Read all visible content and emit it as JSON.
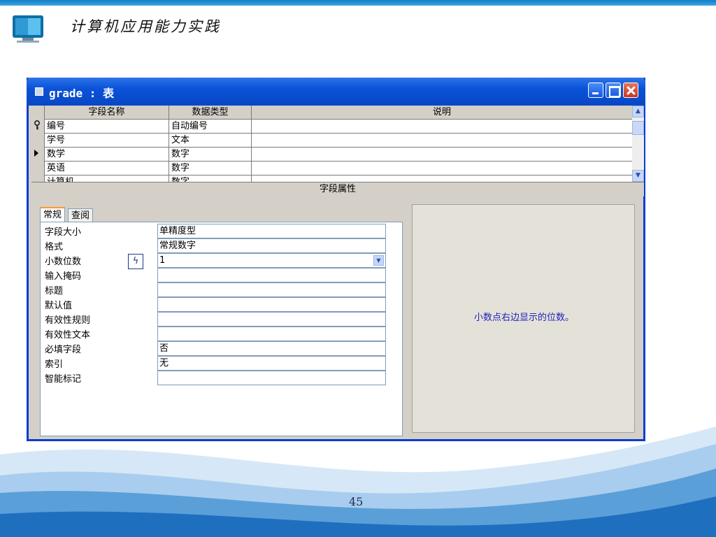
{
  "slide": {
    "title": "计算机应用能力实践",
    "page_number": "45"
  },
  "window": {
    "title": "grade : 表",
    "controls": [
      "minimize",
      "maximize",
      "close"
    ]
  },
  "grid": {
    "columns": [
      "字段名称",
      "数据类型",
      "说明"
    ],
    "rows": [
      {
        "indicator": "key-icon",
        "name": "编号",
        "type": "自动编号",
        "desc": ""
      },
      {
        "indicator": "",
        "name": "学号",
        "type": "文本",
        "desc": ""
      },
      {
        "indicator": "current-row-arrow",
        "name": "数学",
        "type": "数字",
        "desc": ""
      },
      {
        "indicator": "",
        "name": "英语",
        "type": "数字",
        "desc": ""
      },
      {
        "indicator": "",
        "name": "计算机",
        "type": "数字",
        "desc": ""
      }
    ]
  },
  "field_properties": {
    "header": "字段属性",
    "tabs": [
      "常规",
      "查阅"
    ],
    "properties": [
      {
        "label": "字段大小",
        "value": "单精度型"
      },
      {
        "label": "格式",
        "value": "常规数字"
      },
      {
        "label": "小数位数",
        "value": "1"
      },
      {
        "label": "输入掩码",
        "value": ""
      },
      {
        "label": "标题",
        "value": ""
      },
      {
        "label": "默认值",
        "value": ""
      },
      {
        "label": "有效性规则",
        "value": ""
      },
      {
        "label": "有效性文本",
        "value": ""
      },
      {
        "label": "必填字段",
        "value": "否"
      },
      {
        "label": "索引",
        "value": "无"
      },
      {
        "label": "智能标记",
        "value": ""
      }
    ],
    "help_text": "小数点右边显示的位数。"
  },
  "colors": {
    "titlebar": "#0a52d8",
    "help_text": "#2020c0",
    "accent_tab": "#ff9a2e"
  }
}
